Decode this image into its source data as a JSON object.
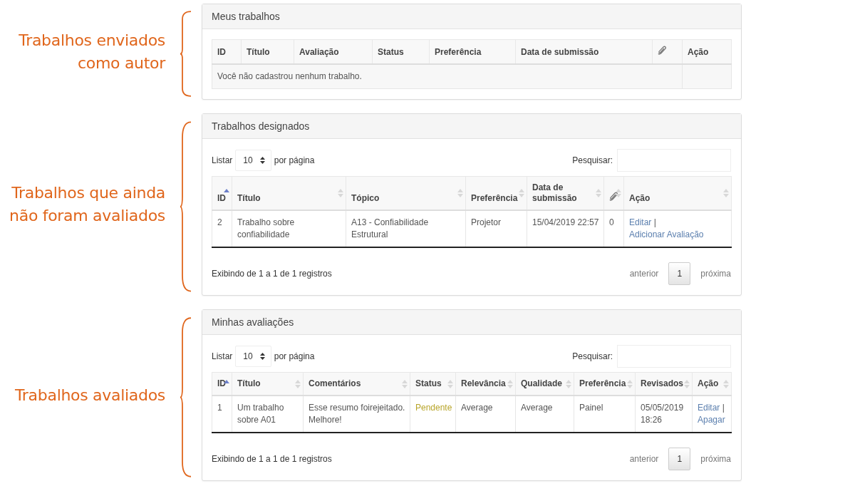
{
  "sections": [
    {
      "annotation": "Trabalhos enviados\ncomo autor",
      "panel": {
        "title": "Meus trabalhos",
        "table": {
          "columns": [
            {
              "kind": "text",
              "label": "ID"
            },
            {
              "kind": "text",
              "label": "Título"
            },
            {
              "kind": "text",
              "label": "Avaliação"
            },
            {
              "kind": "text",
              "label": "Status"
            },
            {
              "kind": "text",
              "label": "Preferência"
            },
            {
              "kind": "text",
              "label": "Data de submissão"
            },
            {
              "kind": "paperclip"
            },
            {
              "kind": "text",
              "label": "Ação"
            }
          ],
          "empty_message": "Você não cadastrou nenhum trabalho."
        }
      }
    },
    {
      "annotation": "Trabalhos que ainda\nnão foram avaliados",
      "panel": {
        "title": "Trabalhos designados",
        "controls": {
          "length_label_before": "Listar",
          "length_value": "10",
          "length_label_after": "por página",
          "search_label": "Pesquisar:"
        },
        "table": {
          "columns": [
            {
              "kind": "text",
              "label": "ID",
              "sorted": true
            },
            {
              "kind": "text",
              "label": "Título",
              "sorted": false
            },
            {
              "kind": "text",
              "label": "Tópico",
              "sorted": false
            },
            {
              "kind": "text",
              "label": "Preferência",
              "sorted": false
            },
            {
              "kind": "text",
              "label": "Data de submissão",
              "sorted": false
            },
            {
              "kind": "paperclip",
              "sorted": false
            },
            {
              "kind": "text",
              "label": "Ação",
              "sorted": false
            }
          ],
          "rows": [
            {
              "cells": [
                {
                  "kind": "text",
                  "text": "2"
                },
                {
                  "kind": "text",
                  "text": "Trabalho sobre confiabilidade"
                },
                {
                  "kind": "text",
                  "text": "A13 - Confiabilidade Estrutural"
                },
                {
                  "kind": "text",
                  "text": "Projetor"
                },
                {
                  "kind": "text",
                  "text": "15/04/2019 22:57"
                },
                {
                  "kind": "text",
                  "text": "0"
                },
                {
                  "kind": "links",
                  "links": [
                    "Editar",
                    "Adicionar Avaliação"
                  ],
                  "separator": "|"
                }
              ]
            }
          ]
        },
        "footer": {
          "info": "Exibindo de 1 a 1 de 1 registros",
          "previous": "anterior",
          "pages": [
            {
              "label": "1",
              "selected": true
            }
          ],
          "next": "próxima"
        }
      }
    },
    {
      "annotation": "Trabalhos avaliados",
      "panel": {
        "title": "Minhas avaliações",
        "controls": {
          "length_label_before": "Listar",
          "length_value": "10",
          "length_label_after": "por página",
          "search_label": "Pesquisar:"
        },
        "table": {
          "columns": [
            {
              "kind": "text",
              "label": "ID",
              "sorted": true
            },
            {
              "kind": "text",
              "label": "Título",
              "sorted": false
            },
            {
              "kind": "text",
              "label": "Comentários",
              "sorted": false
            },
            {
              "kind": "text",
              "label": "Status",
              "sorted": false
            },
            {
              "kind": "text",
              "label": "Relevância",
              "sorted": false
            },
            {
              "kind": "text",
              "label": "Qualidade",
              "sorted": false
            },
            {
              "kind": "text",
              "label": "Preferência",
              "sorted": false
            },
            {
              "kind": "text",
              "label": "Revisados",
              "sorted": false
            },
            {
              "kind": "text",
              "label": "Ação",
              "sorted": false
            }
          ],
          "rows": [
            {
              "cells": [
                {
                  "kind": "text",
                  "text": "1"
                },
                {
                  "kind": "text",
                  "text": "Um trabalho sobre A01"
                },
                {
                  "kind": "text",
                  "text": "Esse resumo foirejeitado. Melhore!"
                },
                {
                  "kind": "status",
                  "text": "Pendente",
                  "color": "#b8a52a"
                },
                {
                  "kind": "text",
                  "text": "Average"
                },
                {
                  "kind": "text",
                  "text": "Average"
                },
                {
                  "kind": "text",
                  "text": "Painel"
                },
                {
                  "kind": "text",
                  "text": "05/05/2019 18:26"
                },
                {
                  "kind": "links",
                  "links": [
                    "Editar",
                    "Apagar"
                  ],
                  "separator": "|"
                }
              ]
            }
          ]
        },
        "footer": {
          "info": "Exibindo de 1 a 1 de 1 registros",
          "previous": "anterior",
          "pages": [
            {
              "label": "1",
              "selected": true
            }
          ],
          "next": "próxima"
        }
      }
    }
  ]
}
